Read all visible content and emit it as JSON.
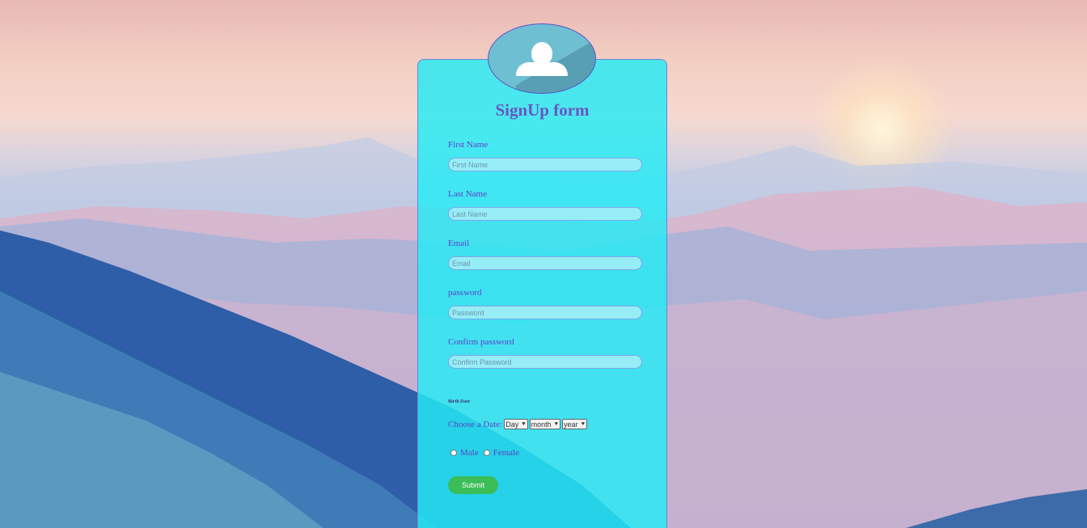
{
  "form": {
    "title": "SignUp form",
    "fields": [
      {
        "label": "First Name",
        "placeholder": "First Name"
      },
      {
        "label": "Last Name",
        "placeholder": "Last Name"
      },
      {
        "label": "Email",
        "placeholder": "Email"
      },
      {
        "label": "password",
        "placeholder": "Password"
      },
      {
        "label": "Confirm password",
        "placeholder": "Confirm Password"
      }
    ],
    "birth_date_label": "Birth Date",
    "date": {
      "label": "Choose a Date:",
      "day": "Day",
      "month": "month",
      "year": "year"
    },
    "gender": {
      "male": "Male",
      "female": "Female"
    },
    "submit_label": "Submit"
  },
  "icons": {
    "avatar": "user-icon",
    "dropdown": "chevron-down-icon"
  },
  "colors": {
    "card": "#23ebf5",
    "title": "#6a55c2",
    "label": "#5b43c9",
    "submit": "#3bbd58"
  }
}
